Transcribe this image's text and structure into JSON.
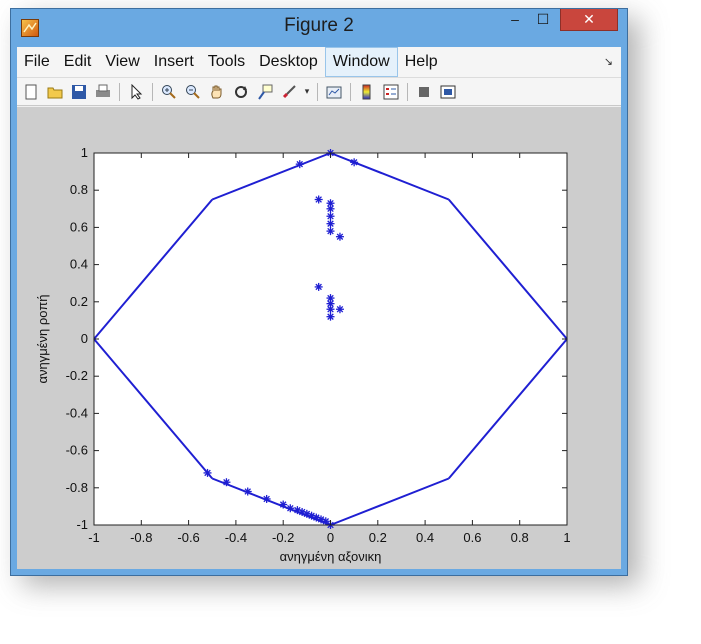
{
  "window": {
    "title": "Figure 2",
    "controls": {
      "minimize": "–",
      "maximize": "☐",
      "close": "✕"
    }
  },
  "menu": {
    "items": [
      "File",
      "Edit",
      "View",
      "Insert",
      "Tools",
      "Desktop",
      "Window",
      "Help"
    ],
    "active": "Window",
    "overflow_icon": "arrow-icon"
  },
  "toolbar": {
    "buttons": [
      {
        "name": "new-figure",
        "icon": "new-icon"
      },
      {
        "name": "open-file",
        "icon": "folder-icon"
      },
      {
        "name": "save-figure",
        "icon": "save-icon"
      },
      {
        "name": "print-figure",
        "icon": "print-icon"
      },
      {
        "name": "edit-plot",
        "icon": "arrow-cursor-icon"
      },
      {
        "name": "zoom-in",
        "icon": "zoom-in-icon"
      },
      {
        "name": "zoom-out",
        "icon": "zoom-out-icon"
      },
      {
        "name": "pan",
        "icon": "hand-icon"
      },
      {
        "name": "rotate-3d",
        "icon": "rotate-icon"
      },
      {
        "name": "data-cursor",
        "icon": "data-cursor-icon"
      },
      {
        "name": "brush",
        "icon": "brush-icon"
      },
      {
        "name": "link-plot",
        "icon": "link-icon"
      },
      {
        "name": "colorbar",
        "icon": "colorbar-icon"
      },
      {
        "name": "legend",
        "icon": "legend-icon"
      },
      {
        "name": "hide-plot-tools",
        "icon": "hide-tools-icon"
      },
      {
        "name": "show-plot-tools",
        "icon": "show-tools-icon"
      }
    ]
  },
  "colors": {
    "line": "#1f1fd2",
    "marker": "#1f1fd2",
    "axes_bg": "#ffffff",
    "figure_bg": "#cdcdcd"
  },
  "chart_data": {
    "type": "scatter",
    "title": "",
    "xlabel": "ανηγμένη αξονικη",
    "ylabel": "ανηγμένη ροπή",
    "xlim": [
      -1,
      1
    ],
    "ylim": [
      -1,
      1
    ],
    "xticks": [
      "-1",
      "-0.8",
      "-0.6",
      "-0.4",
      "-0.2",
      "0",
      "0.2",
      "0.4",
      "0.6",
      "0.8",
      "1"
    ],
    "yticks": [
      "-1",
      "-0.8",
      "-0.6",
      "-0.4",
      "-0.2",
      "0",
      "0.2",
      "0.4",
      "0.6",
      "0.8",
      "1"
    ],
    "grid": false,
    "series": [
      {
        "style": "line",
        "x": [
          0,
          0.5,
          1,
          0.5,
          0,
          -0.5,
          -1,
          -0.5,
          0
        ],
        "y": [
          1,
          0.75,
          0,
          -0.75,
          -1,
          -0.75,
          0,
          0.75,
          1
        ]
      },
      {
        "style": "markers",
        "marker": "*",
        "x": [
          0,
          -0.13,
          0.1,
          -0.05,
          0,
          0,
          0,
          0,
          0,
          0.04,
          -0.05,
          0,
          0,
          0,
          0,
          0.04,
          -0.52,
          -0.44,
          -0.35,
          -0.27,
          -0.2,
          -0.17,
          -0.14,
          -0.12,
          -0.1,
          -0.08,
          -0.06,
          -0.04,
          -0.02,
          0
        ],
        "y": [
          1,
          0.94,
          0.95,
          0.75,
          0.73,
          0.7,
          0.66,
          0.62,
          0.58,
          0.55,
          0.28,
          0.22,
          0.19,
          0.16,
          0.12,
          0.16,
          -0.72,
          -0.77,
          -0.82,
          -0.86,
          -0.89,
          -0.91,
          -0.92,
          -0.93,
          -0.94,
          -0.95,
          -0.96,
          -0.97,
          -0.98,
          -1
        ]
      }
    ]
  }
}
